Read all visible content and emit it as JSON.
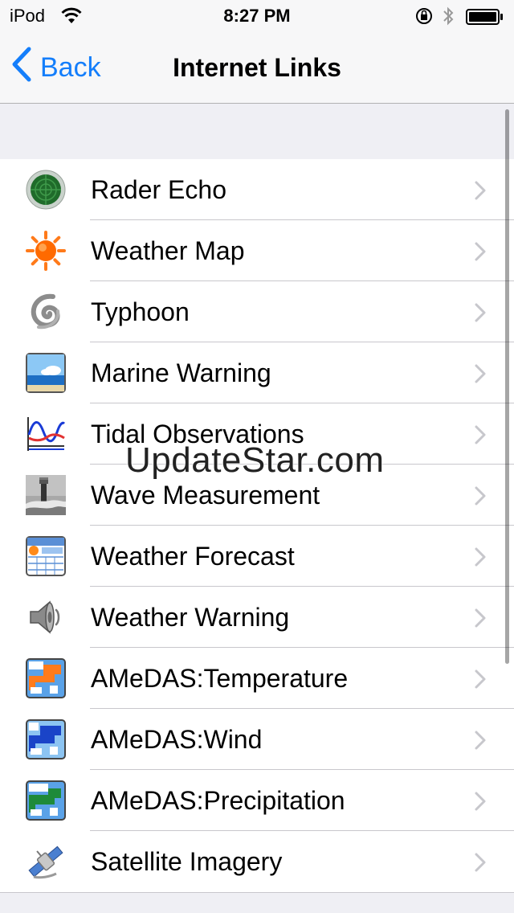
{
  "status_bar": {
    "carrier": "iPod",
    "time": "8:27 PM"
  },
  "nav": {
    "back_label": "Back",
    "title": "Internet Links"
  },
  "items": [
    {
      "label": "Rader Echo",
      "icon": "radar-icon"
    },
    {
      "label": "Weather Map",
      "icon": "sun-icon"
    },
    {
      "label": "Typhoon",
      "icon": "typhoon-icon"
    },
    {
      "label": "Marine Warning",
      "icon": "sea-icon"
    },
    {
      "label": "Tidal Observations",
      "icon": "tide-graph-icon"
    },
    {
      "label": "Wave Measurement",
      "icon": "lighthouse-icon"
    },
    {
      "label": "Weather Forecast",
      "icon": "forecast-table-icon"
    },
    {
      "label": "Weather Warning",
      "icon": "speaker-icon"
    },
    {
      "label": "AMeDAS:Temperature",
      "icon": "temperature-map-icon"
    },
    {
      "label": "AMeDAS:Wind",
      "icon": "wind-map-icon"
    },
    {
      "label": "AMeDAS:Precipitation",
      "icon": "precipitation-map-icon"
    },
    {
      "label": "Satellite Imagery",
      "icon": "satellite-icon"
    }
  ],
  "watermark": "UpdateStar.com",
  "colors": {
    "accent": "#147efb",
    "separator": "#c8c7cc",
    "background": "#efeff4"
  }
}
